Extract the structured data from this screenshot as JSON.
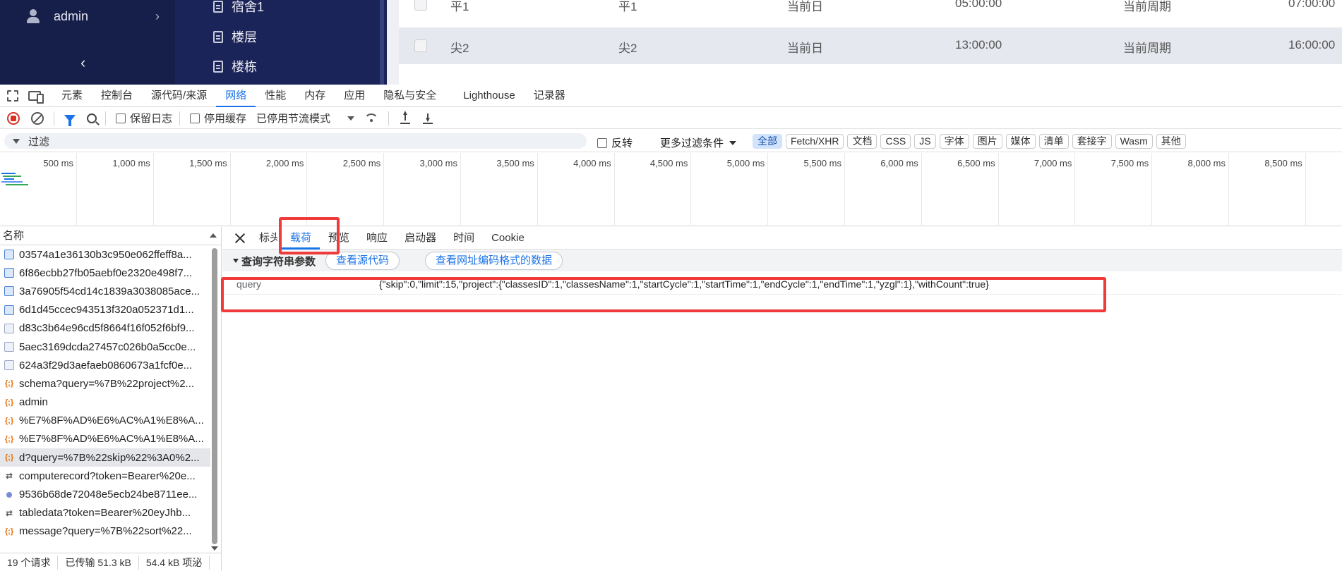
{
  "app": {
    "user_label": "admin",
    "submenu": [
      "宿舍1",
      "楼层",
      "楼栋"
    ],
    "table_rows": [
      {
        "c1": "平1",
        "c2": "平1",
        "c3": "当前日",
        "c4": "05:00:00",
        "c5": "当前周期",
        "c6": "07:00:00"
      },
      {
        "c1": "尖2",
        "c2": "尖2",
        "c3": "当前日",
        "c4": "13:00:00",
        "c5": "当前周期",
        "c6": "16:00:00"
      }
    ]
  },
  "devtools": {
    "tabs": [
      "元素",
      "控制台",
      "源代码/来源",
      "网络",
      "性能",
      "内存",
      "应用",
      "隐私与安全",
      "Lighthouse",
      "记录器"
    ],
    "active_tab": "网络",
    "toolbar": {
      "preserve_log": "保留日志",
      "disable_cache": "停用缓存",
      "throttle": "已停用节流模式"
    },
    "filter": {
      "placeholder": "过滤",
      "invert": "反转",
      "more_filters": "更多过滤条件",
      "types": [
        "全部",
        "Fetch/XHR",
        "文档",
        "CSS",
        "JS",
        "字体",
        "图片",
        "媒体",
        "清单",
        "套接字",
        "Wasm",
        "其他"
      ]
    },
    "timeline_ticks": [
      "500 ms",
      "1,000 ms",
      "1,500 ms",
      "2,000 ms",
      "2,500 ms",
      "3,000 ms",
      "3,500 ms",
      "4,000 ms",
      "4,500 ms",
      "5,000 ms",
      "5,500 ms",
      "6,000 ms",
      "6,500 ms",
      "7,000 ms",
      "7,500 ms",
      "8,000 ms",
      "8,500 ms"
    ],
    "request_list": {
      "header": "名称",
      "items": [
        {
          "name": "03574a1e36130b3c950e062ffeff8a...",
          "icon": "doc"
        },
        {
          "name": "6f86ecbb27fb05aebf0e2320e498f7...",
          "icon": "doc"
        },
        {
          "name": "3a76905f54cd14c1839a3038085ace...",
          "icon": "doc"
        },
        {
          "name": "6d1d45ccec943513f320a052371d1...",
          "icon": "doc"
        },
        {
          "name": "d83c3b64e96cd5f8664f16f052f6bf9...",
          "icon": "img"
        },
        {
          "name": "5aec3169dcda27457c026b0a5cc0e...",
          "icon": "img"
        },
        {
          "name": "624a3f29d3aefaeb0860673a1fcf0e...",
          "icon": "img"
        },
        {
          "name": "schema?query=%7B%22project%2...",
          "icon": "json"
        },
        {
          "name": "admin",
          "icon": "json"
        },
        {
          "name": "%E7%8F%AD%E6%AC%A1%E8%A...",
          "icon": "json"
        },
        {
          "name": "%E7%8F%AD%E6%AC%A1%E8%A...",
          "icon": "json"
        },
        {
          "name": "d?query=%7B%22skip%22%3A0%2...",
          "icon": "json",
          "selected": true
        },
        {
          "name": "computerecord?token=Bearer%20e...",
          "icon": "ws"
        },
        {
          "name": "9536b68de72048e5ecb24be8711ee...",
          "icon": "dot"
        },
        {
          "name": "tabledata?token=Bearer%20eyJhb...",
          "icon": "ws"
        },
        {
          "name": "message?query=%7B%22sort%22...",
          "icon": "json"
        }
      ],
      "status": [
        "19 个请求",
        "已传输 51.3 kB",
        "54.4 kB 项泌"
      ]
    },
    "detail": {
      "tabs": [
        "标头",
        "载荷",
        "预览",
        "响应",
        "启动器",
        "时间",
        "Cookie"
      ],
      "active_tab": "载荷",
      "section_title": "查询字符串参数",
      "view_source": "查看源代码",
      "view_url_encoded": "查看网址编码格式的数据",
      "param_key": "query",
      "param_value": "{\"skip\":0,\"limit\":15,\"project\":{\"classesID\":1,\"classesName\":1,\"startCycle\":1,\"startTime\":1,\"endCycle\":1,\"endTime\":1,\"yzgl\":1},\"withCount\":true}"
    }
  },
  "colors": {
    "accent": "#1a73e8",
    "annotation": "#ef3b3b",
    "sidebar": "#161e4a"
  }
}
